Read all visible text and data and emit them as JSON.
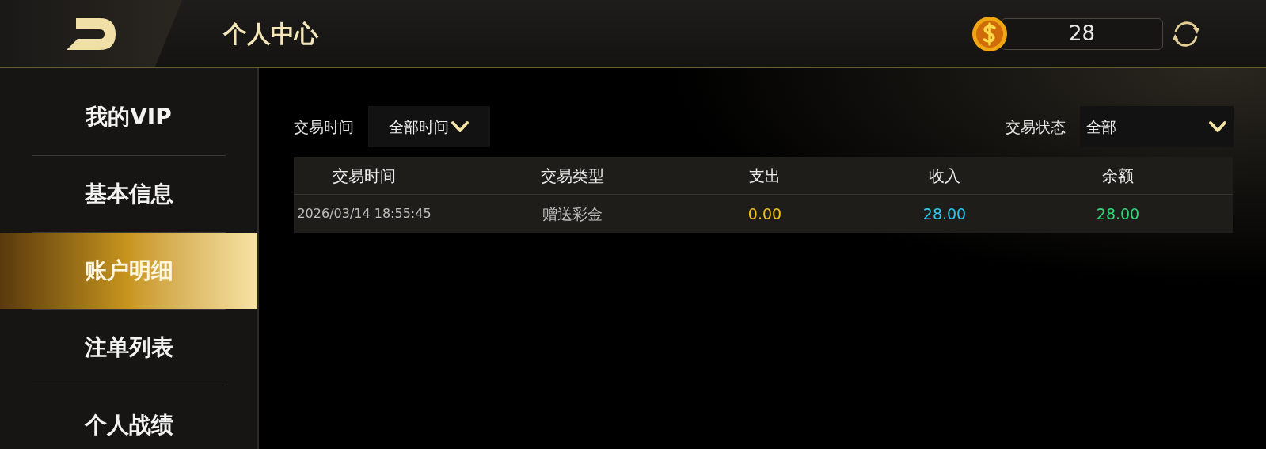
{
  "header": {
    "title": "个人中心",
    "balance": "28"
  },
  "sidebar": {
    "items": [
      {
        "label": "我的VIP",
        "selected": false
      },
      {
        "label": "基本信息",
        "selected": false
      },
      {
        "label": "账户明细",
        "selected": true
      },
      {
        "label": "注单列表",
        "selected": false
      },
      {
        "label": "个人战绩",
        "selected": false
      }
    ]
  },
  "filters": [
    {
      "label": "交易时间",
      "value": "全部时间"
    },
    {
      "label": "交易状态",
      "value": "全部"
    }
  ],
  "table": {
    "columns": [
      "交易时间",
      "交易类型",
      "支出",
      "收入",
      "余额"
    ],
    "rows": [
      {
        "cells": [
          {
            "text": "2026/03/14 18:55:45"
          },
          {
            "text": "赠送彩金"
          },
          {
            "text": "0.00",
            "color": "#f2c21b"
          },
          {
            "text": "28.00",
            "color": "#2ec6ea"
          },
          {
            "text": "28.00",
            "color": "#2fd67a"
          }
        ]
      }
    ]
  }
}
